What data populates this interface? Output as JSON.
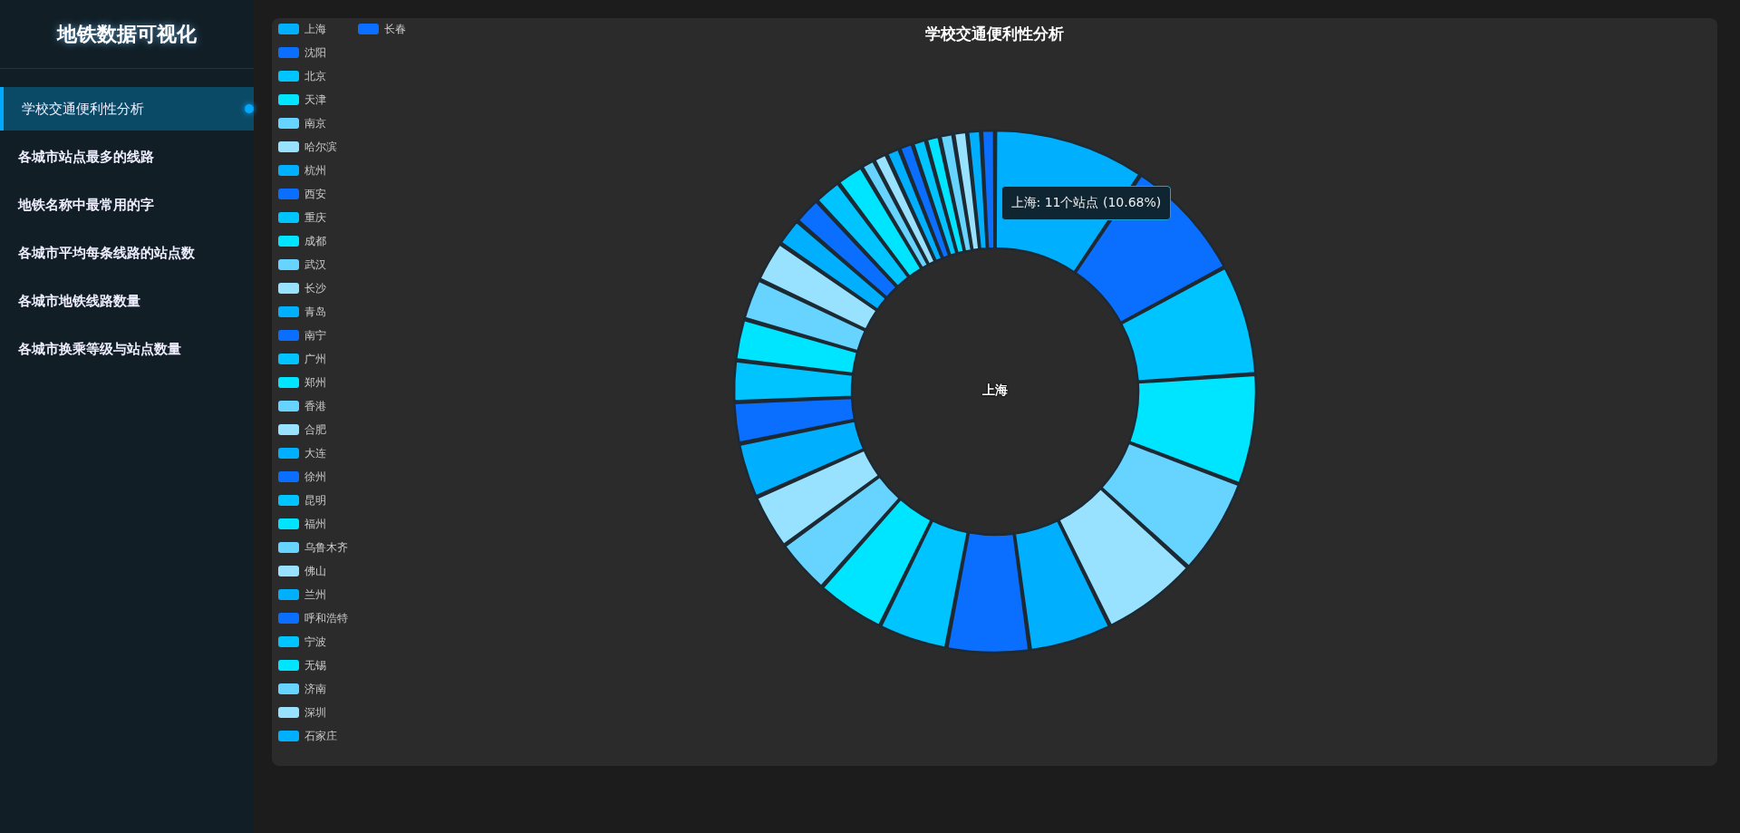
{
  "sidebar": {
    "title": "地铁数据可视化",
    "items": [
      {
        "label": "学校交通便利性分析",
        "selected": true
      },
      {
        "label": "各城市站点最多的线路",
        "selected": false
      },
      {
        "label": "地铁名称中最常用的字",
        "selected": false
      },
      {
        "label": "各城市平均每条线路的站点数",
        "selected": false
      },
      {
        "label": "各城市地铁线路数量",
        "selected": false
      },
      {
        "label": "各城市换乘等级与站点数量",
        "selected": false
      }
    ]
  },
  "chart": {
    "title": "学校交通便利性分析",
    "center_label": "上海",
    "tooltip": "上海: 11个站点 (10.68%)",
    "legend": [
      {
        "label": "上海",
        "color": "#00b0ff"
      },
      {
        "label": "沈阳",
        "color": "#0a6fff"
      },
      {
        "label": "北京",
        "color": "#00c4ff"
      },
      {
        "label": "天津",
        "color": "#00e5ff"
      },
      {
        "label": "南京",
        "color": "#66d4ff"
      },
      {
        "label": "哈尔滨",
        "color": "#99e2ff"
      },
      {
        "label": "杭州",
        "color": "#00b0ff"
      },
      {
        "label": "西安",
        "color": "#0a6fff"
      },
      {
        "label": "重庆",
        "color": "#00c4ff"
      },
      {
        "label": "成都",
        "color": "#00e5ff"
      },
      {
        "label": "武汉",
        "color": "#66d4ff"
      },
      {
        "label": "长沙",
        "color": "#99e2ff"
      },
      {
        "label": "青岛",
        "color": "#00b0ff"
      },
      {
        "label": "南宁",
        "color": "#0a6fff"
      },
      {
        "label": "广州",
        "color": "#00c4ff"
      },
      {
        "label": "郑州",
        "color": "#00e5ff"
      },
      {
        "label": "香港",
        "color": "#66d4ff"
      },
      {
        "label": "合肥",
        "color": "#99e2ff"
      },
      {
        "label": "大连",
        "color": "#00b0ff"
      },
      {
        "label": "徐州",
        "color": "#0a6fff"
      },
      {
        "label": "昆明",
        "color": "#00c4ff"
      },
      {
        "label": "福州",
        "color": "#00e5ff"
      },
      {
        "label": "乌鲁木齐",
        "color": "#66d4ff"
      },
      {
        "label": "佛山",
        "color": "#99e2ff"
      },
      {
        "label": "兰州",
        "color": "#00b0ff"
      },
      {
        "label": "呼和浩特",
        "color": "#0a6fff"
      },
      {
        "label": "宁波",
        "color": "#00c4ff"
      },
      {
        "label": "无锡",
        "color": "#00e5ff"
      },
      {
        "label": "济南",
        "color": "#66d4ff"
      },
      {
        "label": "深圳",
        "color": "#99e2ff"
      },
      {
        "label": "石家庄",
        "color": "#00b0ff"
      },
      {
        "label": "长春",
        "color": "#0a6fff"
      }
    ]
  }
}
